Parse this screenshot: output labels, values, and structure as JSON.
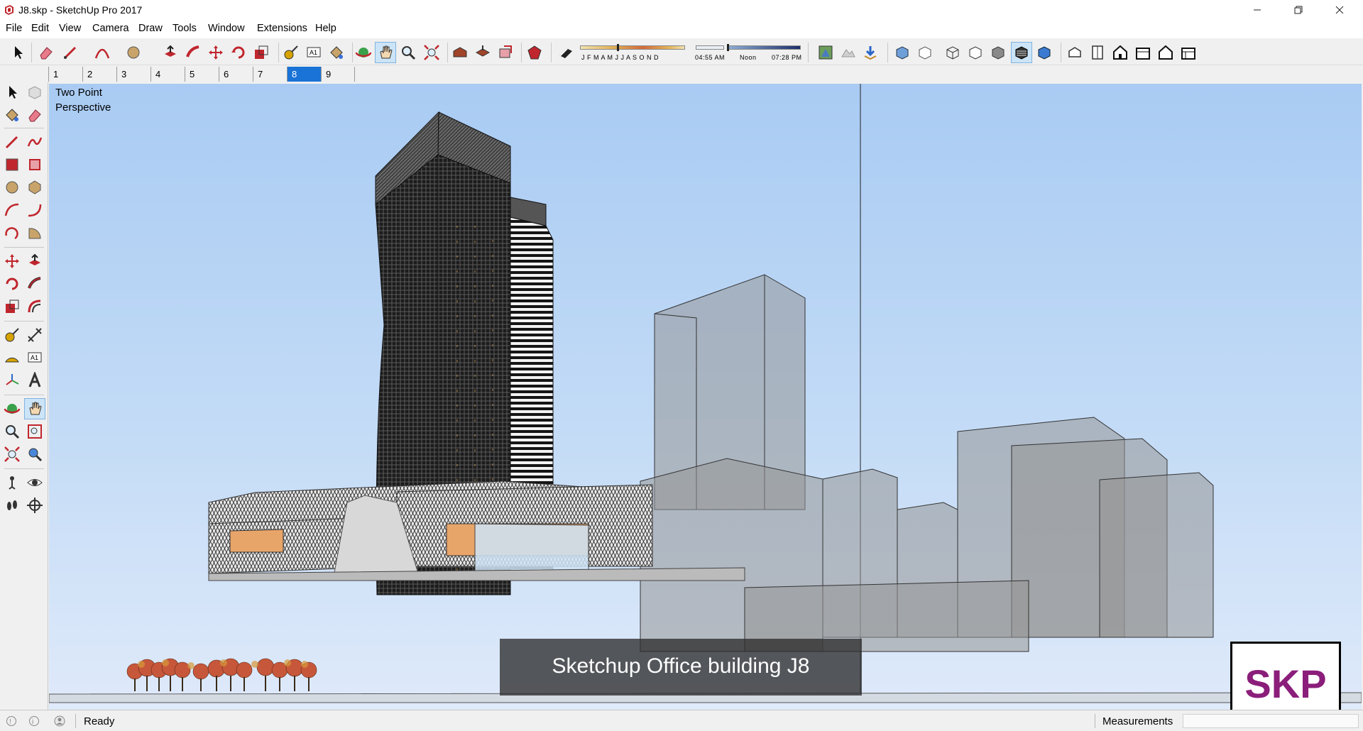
{
  "window": {
    "title": "J8.skp - SketchUp Pro 2017",
    "minimize_icon": "minimize-icon",
    "maximize_icon": "restore-icon",
    "close_icon": "close-icon"
  },
  "menu": {
    "items": [
      {
        "label": "File"
      },
      {
        "label": "Edit"
      },
      {
        "label": "View"
      },
      {
        "label": "Camera"
      },
      {
        "label": "Draw"
      },
      {
        "label": "Tools"
      },
      {
        "label": "Window"
      },
      {
        "label": "Extensions"
      },
      {
        "label": "Help"
      }
    ]
  },
  "toolbar": {
    "shadow": {
      "months": "J F M A M J J A S O N D",
      "time_start": "04:55 AM",
      "time_mid": "Noon",
      "time_end": "07:28 PM"
    }
  },
  "scenes": {
    "tabs": [
      {
        "label": "1"
      },
      {
        "label": "2"
      },
      {
        "label": "3"
      },
      {
        "label": "4"
      },
      {
        "label": "5"
      },
      {
        "label": "6"
      },
      {
        "label": "7"
      },
      {
        "label": "8"
      },
      {
        "label": "9"
      }
    ],
    "active": "8"
  },
  "viewport": {
    "camera_mode": "Two Point\nPerspective",
    "caption": "Sketchup Office building J8",
    "logo": "SKP"
  },
  "status": {
    "text": "Ready",
    "measurements_label": "Measurements",
    "measurements_value": ""
  },
  "colors": {
    "active_tab": "#1a73d6",
    "sky_top": "#a9cbf3",
    "sky_bottom": "#dfeafa",
    "logo_text": "#8a1e7a"
  }
}
